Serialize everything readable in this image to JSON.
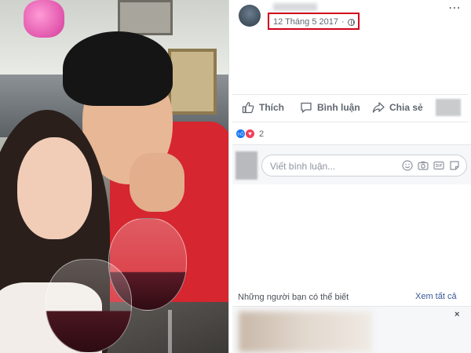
{
  "post": {
    "date": "12 Tháng 5 2017",
    "separator": "·",
    "more_icon": "⋯"
  },
  "actions": {
    "like_label": "Thích",
    "comment_label": "Bình luận",
    "share_label": "Chia sẻ"
  },
  "reactions": {
    "count": "2",
    "types": [
      "like-icon",
      "love-icon"
    ]
  },
  "comment": {
    "placeholder": "Viết bình luận..."
  },
  "suggestions": {
    "title": "Những người bạn có thể biết",
    "see_all": "Xem tất cả",
    "close": "×"
  },
  "colors": {
    "highlight_box": "#d0021b",
    "like_blue": "#1877f2",
    "love_red": "#f33e58",
    "link_blue": "#385898"
  }
}
